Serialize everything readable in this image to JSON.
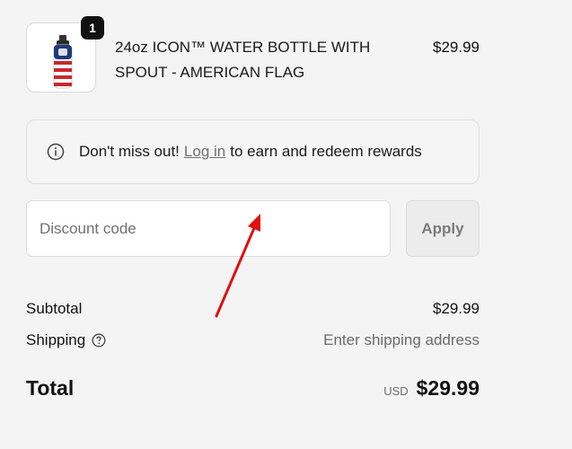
{
  "product": {
    "quantity": "1",
    "title": "24oz ICON™ WATER BOTTLE WITH SPOUT - AMERICAN FLAG",
    "price": "$29.99"
  },
  "rewards": {
    "prefix": "Don't miss out!",
    "login_link": "Log in",
    "suffix": "to earn and redeem rewards"
  },
  "discount": {
    "placeholder": "Discount code",
    "apply_label": "Apply"
  },
  "summary": {
    "subtotal_label": "Subtotal",
    "subtotal_value": "$29.99",
    "shipping_label": "Shipping",
    "shipping_value": "Enter shipping address",
    "total_label": "Total",
    "currency": "USD",
    "total_value": "$29.99"
  },
  "colors": {
    "background": "#f4f4f4",
    "annotation_arrow": "#e01010"
  }
}
